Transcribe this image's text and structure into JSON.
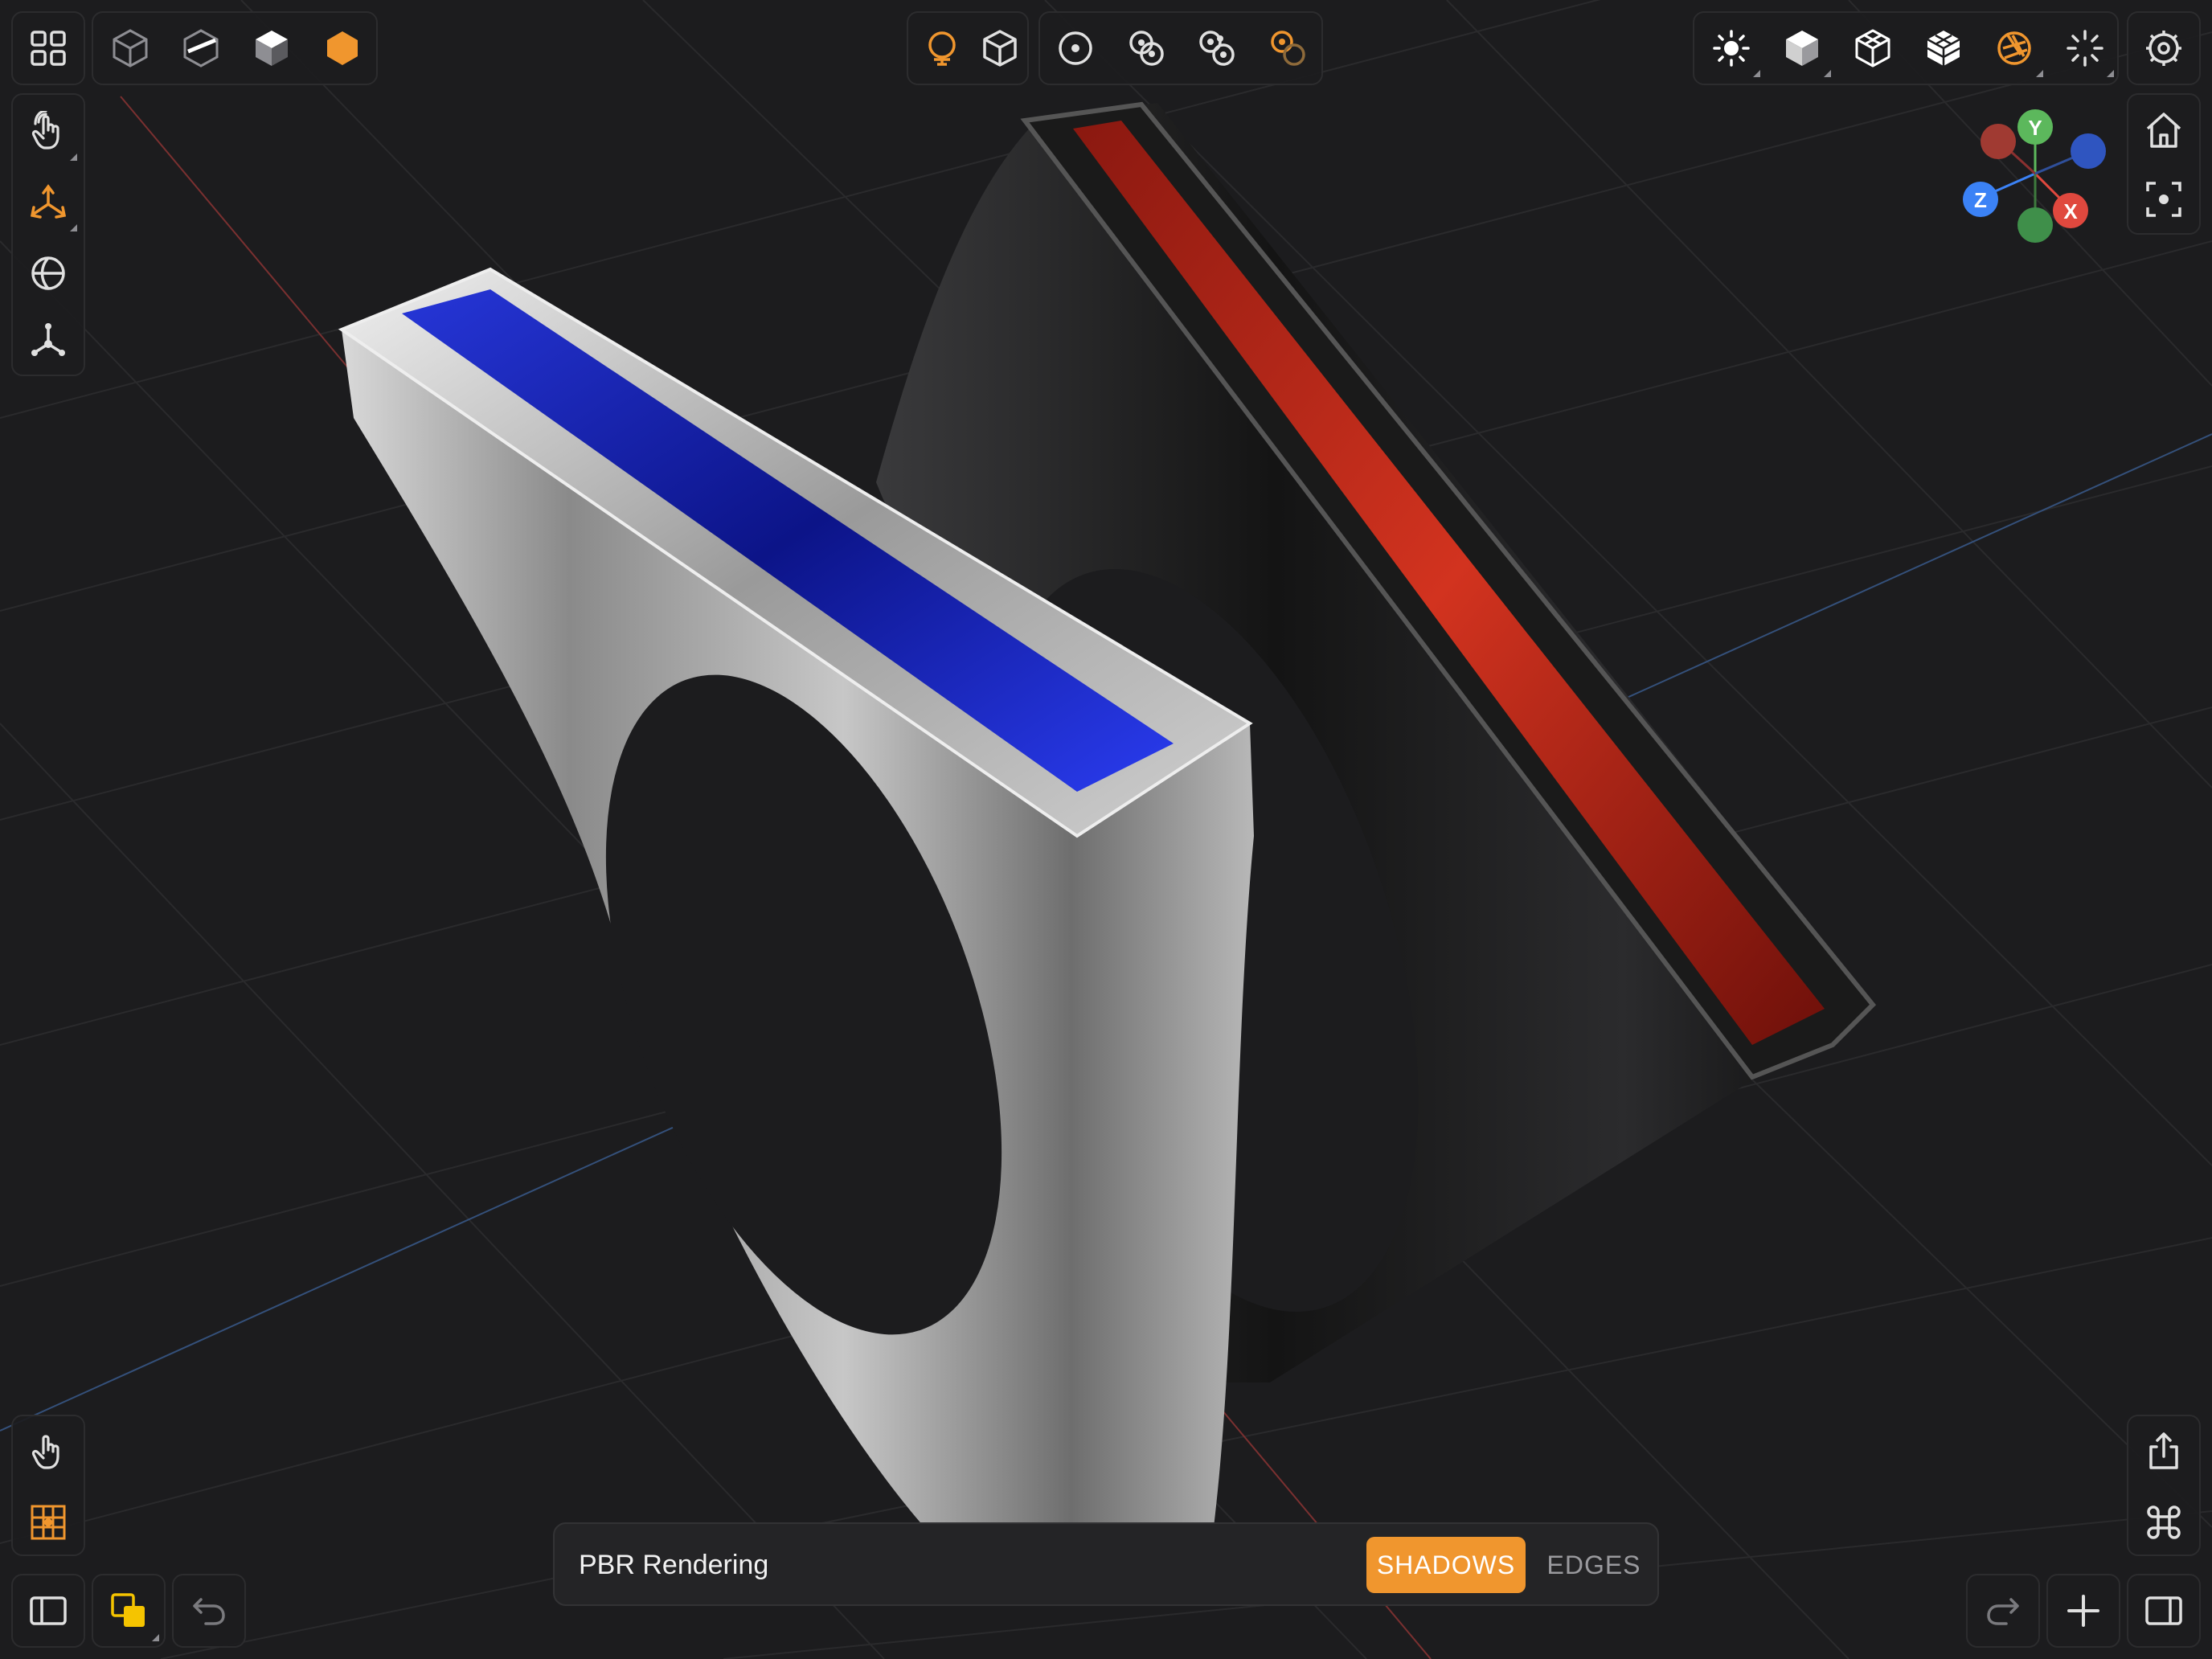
{
  "status_bar": {
    "title": "PBR Rendering",
    "shadows_label": "SHADOWS",
    "edges_label": "EDGES"
  },
  "gizmo": {
    "y_label": "Y",
    "x_label": "X",
    "z_label": "Z"
  },
  "colors": {
    "accent": "#f0962e",
    "background": "#1c1c1e",
    "x_axis": "#e0483e",
    "y_axis": "#5cb85c",
    "z_axis": "#3b82f6",
    "gem_blue": "#1d2bb8",
    "gem_red": "#c0281f"
  },
  "icons": {
    "top_left": [
      "grid-icon",
      "wireframe-cube-icon",
      "cube-slice-icon",
      "solid-cube-icon",
      "hexagon-filled-icon"
    ],
    "top_center": [
      "material-ball-icon",
      "cube-outline-icon",
      "point-icon",
      "two-points-icon",
      "three-points-icon",
      "point-orange-icon"
    ],
    "top_right": [
      "sun-icon",
      "solid-cube-icon",
      "wire-cube-icon",
      "shaded-wire-cube-icon",
      "aperture-icon",
      "sparkle-icon",
      "settings-icon"
    ],
    "left_tools": [
      "hand-pointer-icon",
      "move-axes-icon",
      "globe-icon",
      "node-icon"
    ],
    "right_tools": [
      "home-icon",
      "focus-icon"
    ],
    "bottom_left": [
      "touch-icon",
      "snap-grid-icon",
      "sidebar-icon",
      "layers-icon",
      "undo-icon"
    ],
    "bottom_right": [
      "share-icon",
      "command-icon",
      "redo-icon",
      "add-icon",
      "right-panel-icon"
    ]
  }
}
